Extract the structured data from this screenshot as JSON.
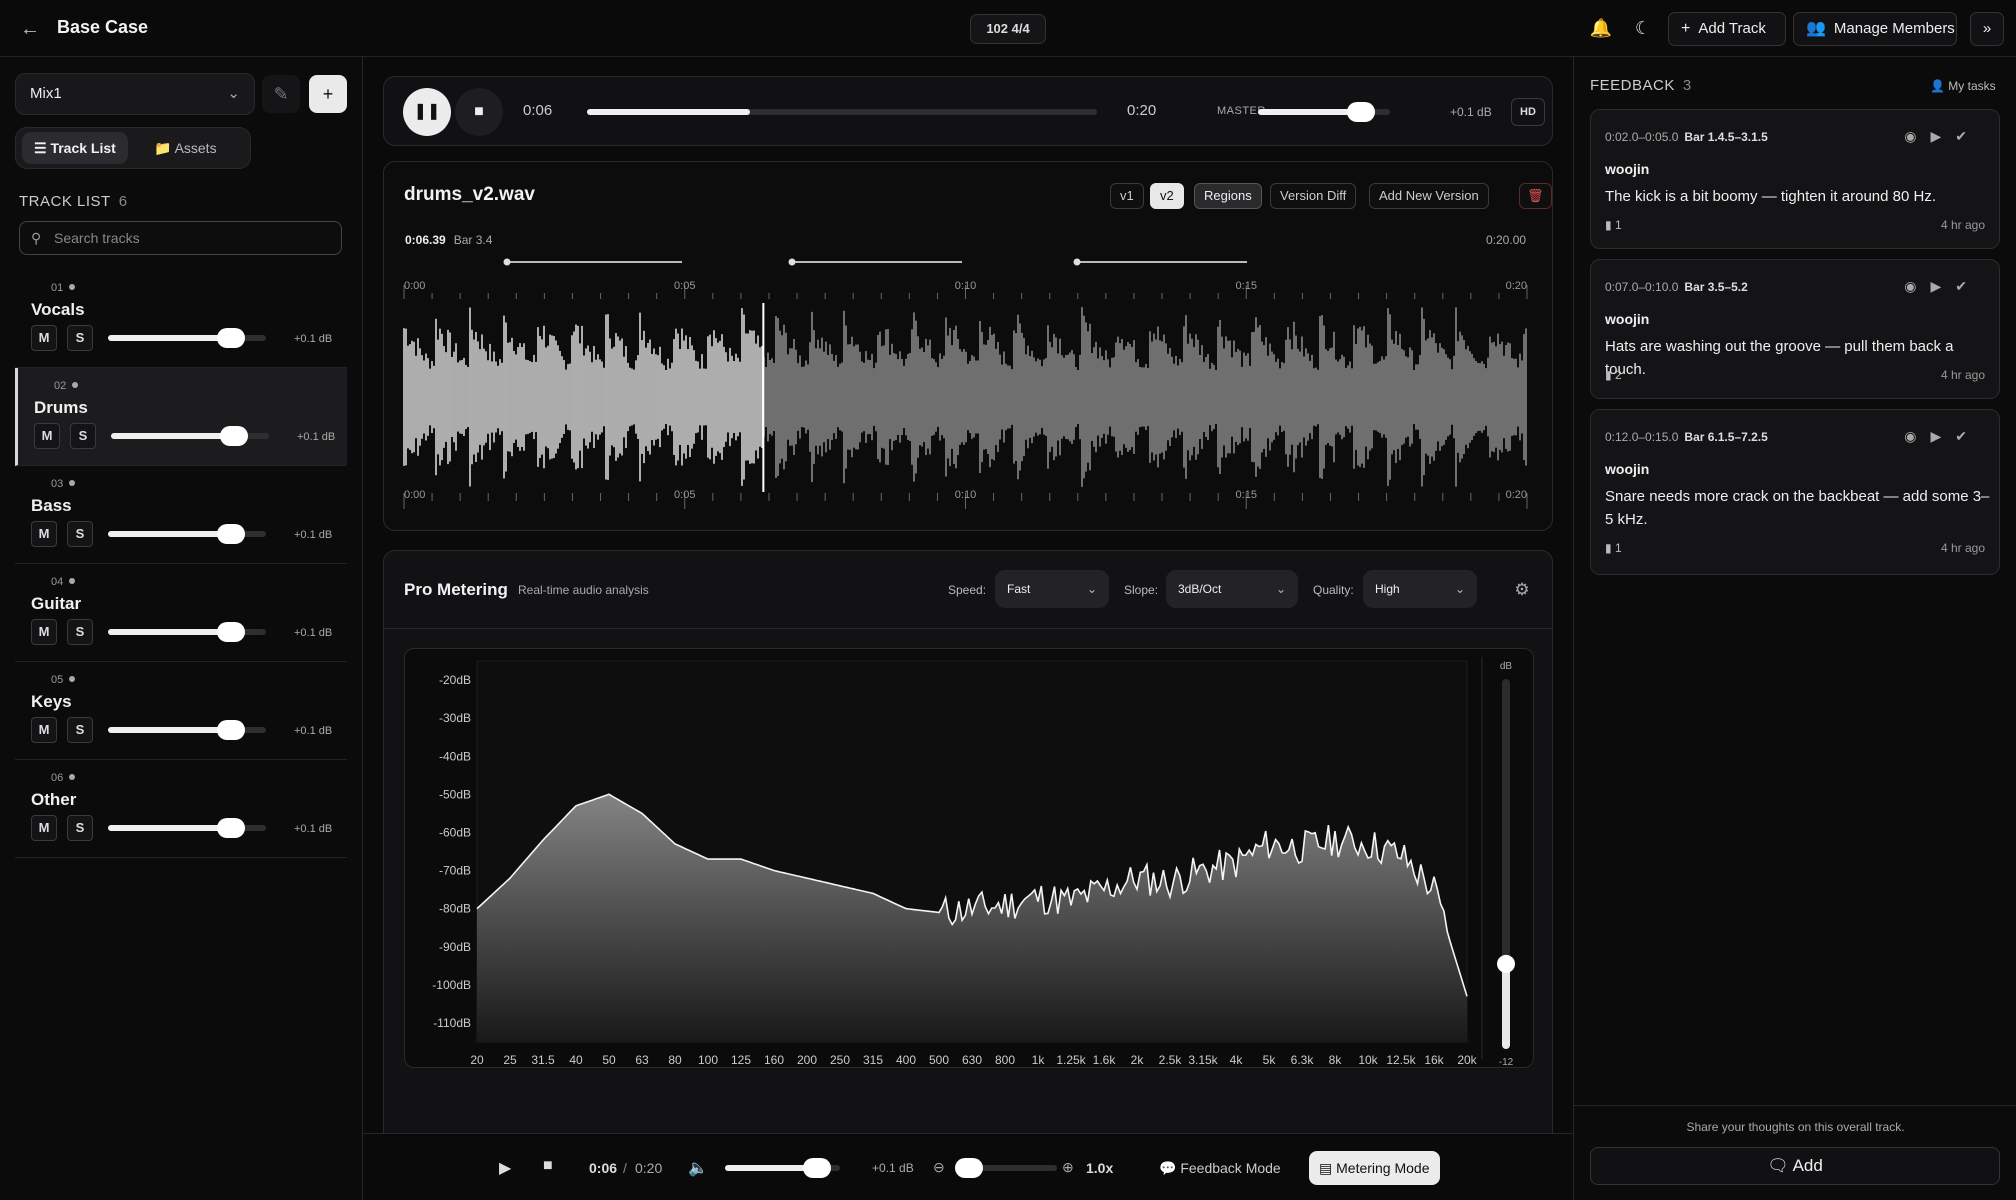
{
  "header": {
    "title": "Base Case",
    "tempo": "102 4/4",
    "add_track": "Add Track",
    "manage_members": "Manage Members"
  },
  "sidebar": {
    "mix": "Mix1",
    "tabs": [
      "Track List",
      "Assets"
    ],
    "heading": "TRACK LIST",
    "count": "6",
    "search_placeholder": "Search tracks",
    "tracks": [
      {
        "num": "01",
        "name": "Vocals",
        "mute": "M",
        "solo": "S",
        "db": "+0.1 dB",
        "level": 0.78
      },
      {
        "num": "02",
        "name": "Drums",
        "mute": "M",
        "solo": "S",
        "db": "+0.1 dB",
        "level": 0.78
      },
      {
        "num": "03",
        "name": "Bass",
        "mute": "M",
        "solo": "S",
        "db": "+0.1 dB",
        "level": 0.78
      },
      {
        "num": "04",
        "name": "Guitar",
        "mute": "M",
        "solo": "S",
        "db": "+0.1 dB",
        "level": 0.78
      },
      {
        "num": "05",
        "name": "Keys",
        "mute": "M",
        "solo": "S",
        "db": "+0.1 dB",
        "level": 0.78
      },
      {
        "num": "06",
        "name": "Other",
        "mute": "M",
        "solo": "S",
        "db": "+0.1 dB",
        "level": 0.78
      }
    ]
  },
  "transport": {
    "current": "0:06",
    "total": "0:20",
    "progress": 0.32,
    "master_label": "MASTER",
    "master_db": "+0.1 dB",
    "master_level": 0.78,
    "hd": "HD"
  },
  "waveform": {
    "filename": "drums_v2.wav",
    "versions": [
      "v1",
      "v2"
    ],
    "regions": "Regions",
    "version_diff": "Version Diff",
    "add_version": "Add New Version",
    "position": "0:06.39",
    "bar": "Bar 3.4",
    "end": "0:20.00",
    "ticks": [
      "0:00",
      "0:05",
      "0:10",
      "0:15",
      "0:20"
    ],
    "playhead_fraction": 0.32
  },
  "metering": {
    "title": "Pro Metering",
    "subtitle": "Real-time audio analysis",
    "speed_label": "Speed:",
    "speed": "Fast",
    "slope_label": "Slope:",
    "slope": "3dB/Oct",
    "quality_label": "Quality:",
    "quality": "High",
    "db_unit": "dB",
    "meter_value": "-12",
    "meter_level": 0.23,
    "add_plus": "+"
  },
  "chart_data": {
    "type": "area",
    "y_ticks": [
      "-20dB",
      "-30dB",
      "-40dB",
      "-50dB",
      "-60dB",
      "-70dB",
      "-80dB",
      "-90dB",
      "-100dB",
      "-110dB"
    ],
    "x_ticks": [
      "20",
      "25",
      "31.5",
      "40",
      "50",
      "63",
      "80",
      "100",
      "125",
      "160",
      "200",
      "250",
      "315",
      "400",
      "500",
      "630",
      "800",
      "1k",
      "1.25k",
      "1.6k",
      "2k",
      "2.5k",
      "3.15k",
      "4k",
      "5k",
      "6.3k",
      "8k",
      "10k",
      "12.5k",
      "16k",
      "20k"
    ],
    "ylim": [
      -115,
      -15
    ],
    "series": [
      {
        "values": [
          -80,
          -72,
          -62,
          -53,
          -50,
          -55,
          -63,
          -67,
          -67,
          -70,
          -72,
          -74,
          -76,
          -80,
          -81,
          -80,
          -79,
          -77,
          -78,
          -75,
          -72,
          -73,
          -70,
          -68,
          -63,
          -64,
          -62,
          -63,
          -66,
          -75,
          -103
        ]
      }
    ]
  },
  "bottom": {
    "current": "0:06",
    "sep": "/",
    "total": "0:20",
    "volume_db": "+0.1 dB",
    "volume_level": 0.8,
    "zoom": "1.0x",
    "zoom_level": 0.12,
    "feedback_mode": "Feedback Mode",
    "metering_mode": "Metering Mode"
  },
  "feedback": {
    "heading": "FEEDBACK",
    "count": "3",
    "my_tasks": "My tasks",
    "items": [
      {
        "range": "0:02.0–0:05.0",
        "bar": "Bar 1.4.5–3.1.5",
        "author": "woojin",
        "text": "The kick is a bit boomy — tighten it around 80 Hz.",
        "comments": "1",
        "ago": "4 hr ago"
      },
      {
        "range": "0:07.0–0:10.0",
        "bar": "Bar 3.5–5.2",
        "author": "woojin",
        "text": "Hats are washing out the groove — pull them back a touch.",
        "comments": "2",
        "ago": "4 hr ago"
      },
      {
        "range": "0:12.0–0:15.0",
        "bar": "Bar 6.1.5–7.2.5",
        "author": "woojin",
        "text": "Snare needs more crack on the backbeat — add some 3–5 kHz.",
        "comments": "1",
        "ago": "4 hr ago"
      }
    ],
    "share_prompt": "Share your thoughts on this overall track.",
    "add": "Add"
  }
}
